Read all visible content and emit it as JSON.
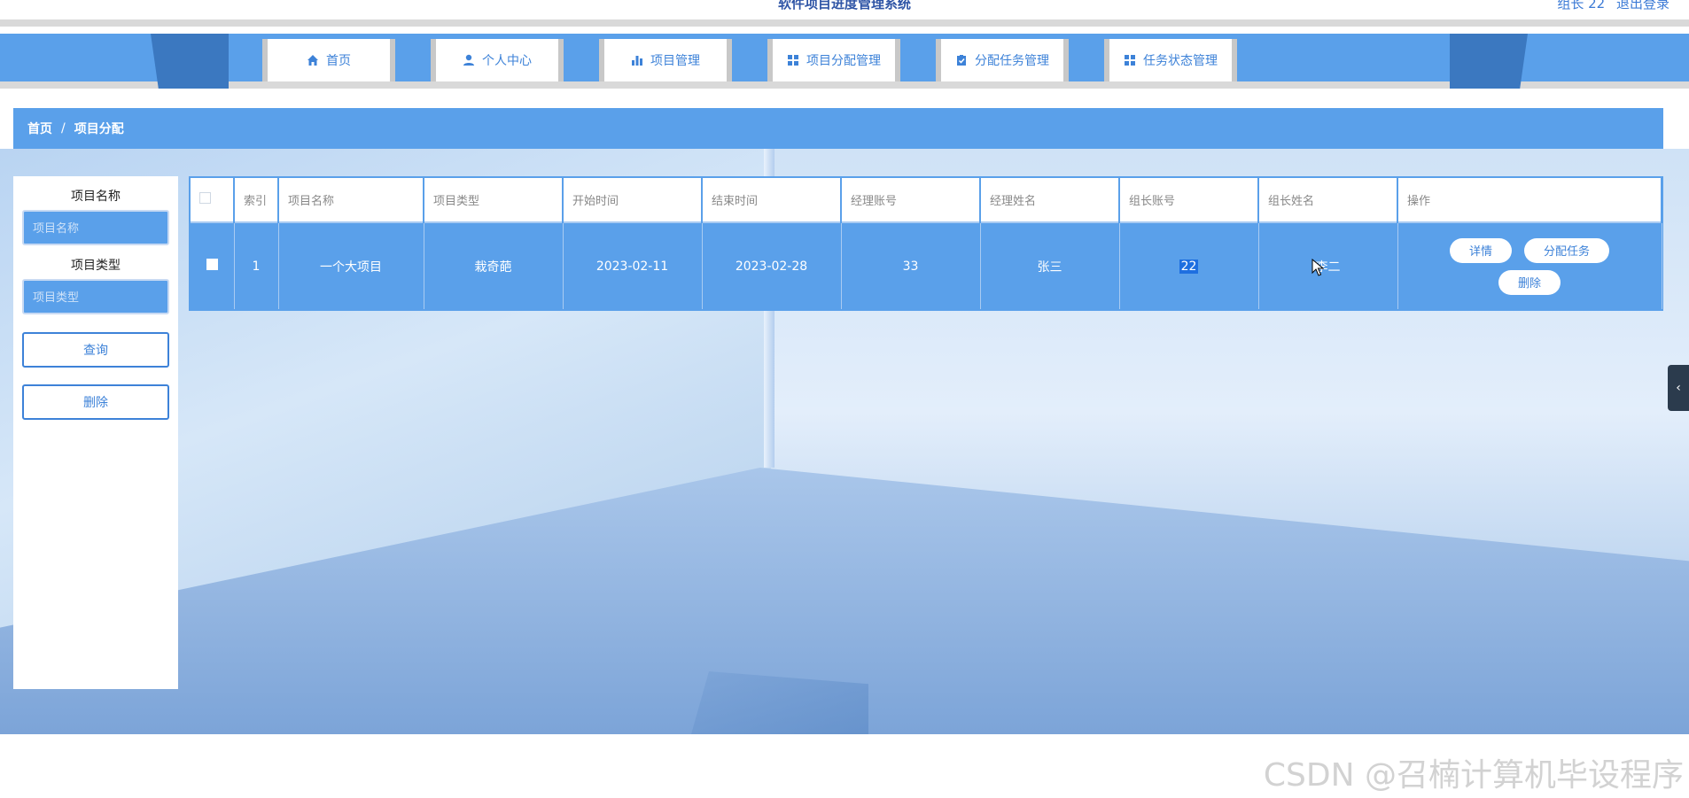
{
  "header": {
    "app_title": "软件项目进度管理系统",
    "user_label": "组长 22",
    "logout_label": "退出登录"
  },
  "nav": [
    {
      "label": "首页",
      "icon": "home-icon"
    },
    {
      "label": "个人中心",
      "icon": "user-icon"
    },
    {
      "label": "项目管理",
      "icon": "bar-chart-icon"
    },
    {
      "label": "项目分配管理",
      "icon": "grid-icon"
    },
    {
      "label": "分配任务管理",
      "icon": "clipboard-icon"
    },
    {
      "label": "任务状态管理",
      "icon": "grid-icon"
    }
  ],
  "breadcrumb": {
    "home": "首页",
    "separator": "/",
    "current": "项目分配"
  },
  "filters": {
    "name_label": "项目名称",
    "name_placeholder": "项目名称",
    "type_label": "项目类型",
    "type_placeholder": "项目类型",
    "search_button": "查询",
    "delete_button": "删除"
  },
  "table": {
    "columns": [
      "索引",
      "项目名称",
      "项目类型",
      "开始时间",
      "结束时间",
      "经理账号",
      "经理姓名",
      "组长账号",
      "组长姓名",
      "操作"
    ],
    "rows": [
      {
        "index": "1",
        "project_name": "一个大项目",
        "project_type": "栽奇葩",
        "start_time": "2023-02-11",
        "end_time": "2023-02-28",
        "manager_account": "33",
        "manager_name": "张三",
        "leader_account": "22",
        "leader_name": "李二"
      }
    ],
    "actions": {
      "detail": "详情",
      "assign": "分配任务",
      "delete": "删除"
    }
  },
  "side_toggle_icon": "chevron-left-icon",
  "watermark": "CSDN @召楠计算机毕设程序",
  "colors": {
    "primary": "#5aa0ea",
    "nav_dark": "#3b78c0",
    "accent_text": "#3d82d8"
  }
}
